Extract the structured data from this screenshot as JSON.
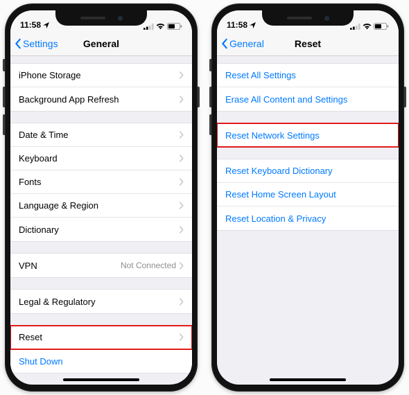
{
  "status": {
    "time": "11:58"
  },
  "left": {
    "back": "Settings",
    "title": "General",
    "g1": [
      {
        "label": "iPhone Storage"
      },
      {
        "label": "Background App Refresh"
      }
    ],
    "g2": [
      {
        "label": "Date & Time"
      },
      {
        "label": "Keyboard"
      },
      {
        "label": "Fonts"
      },
      {
        "label": "Language & Region"
      },
      {
        "label": "Dictionary"
      }
    ],
    "g3": [
      {
        "label": "VPN",
        "value": "Not Connected"
      }
    ],
    "g4": [
      {
        "label": "Legal & Regulatory"
      }
    ],
    "g5": [
      {
        "label": "Reset",
        "highlight": true
      },
      {
        "label": "Shut Down",
        "blue": true,
        "noChevron": true
      }
    ]
  },
  "right": {
    "back": "General",
    "title": "Reset",
    "g1": [
      {
        "label": "Reset All Settings"
      },
      {
        "label": "Erase All Content and Settings"
      }
    ],
    "g2": [
      {
        "label": "Reset Network Settings",
        "highlight": true
      }
    ],
    "g3": [
      {
        "label": "Reset Keyboard Dictionary"
      },
      {
        "label": "Reset Home Screen Layout"
      },
      {
        "label": "Reset Location & Privacy"
      }
    ]
  }
}
